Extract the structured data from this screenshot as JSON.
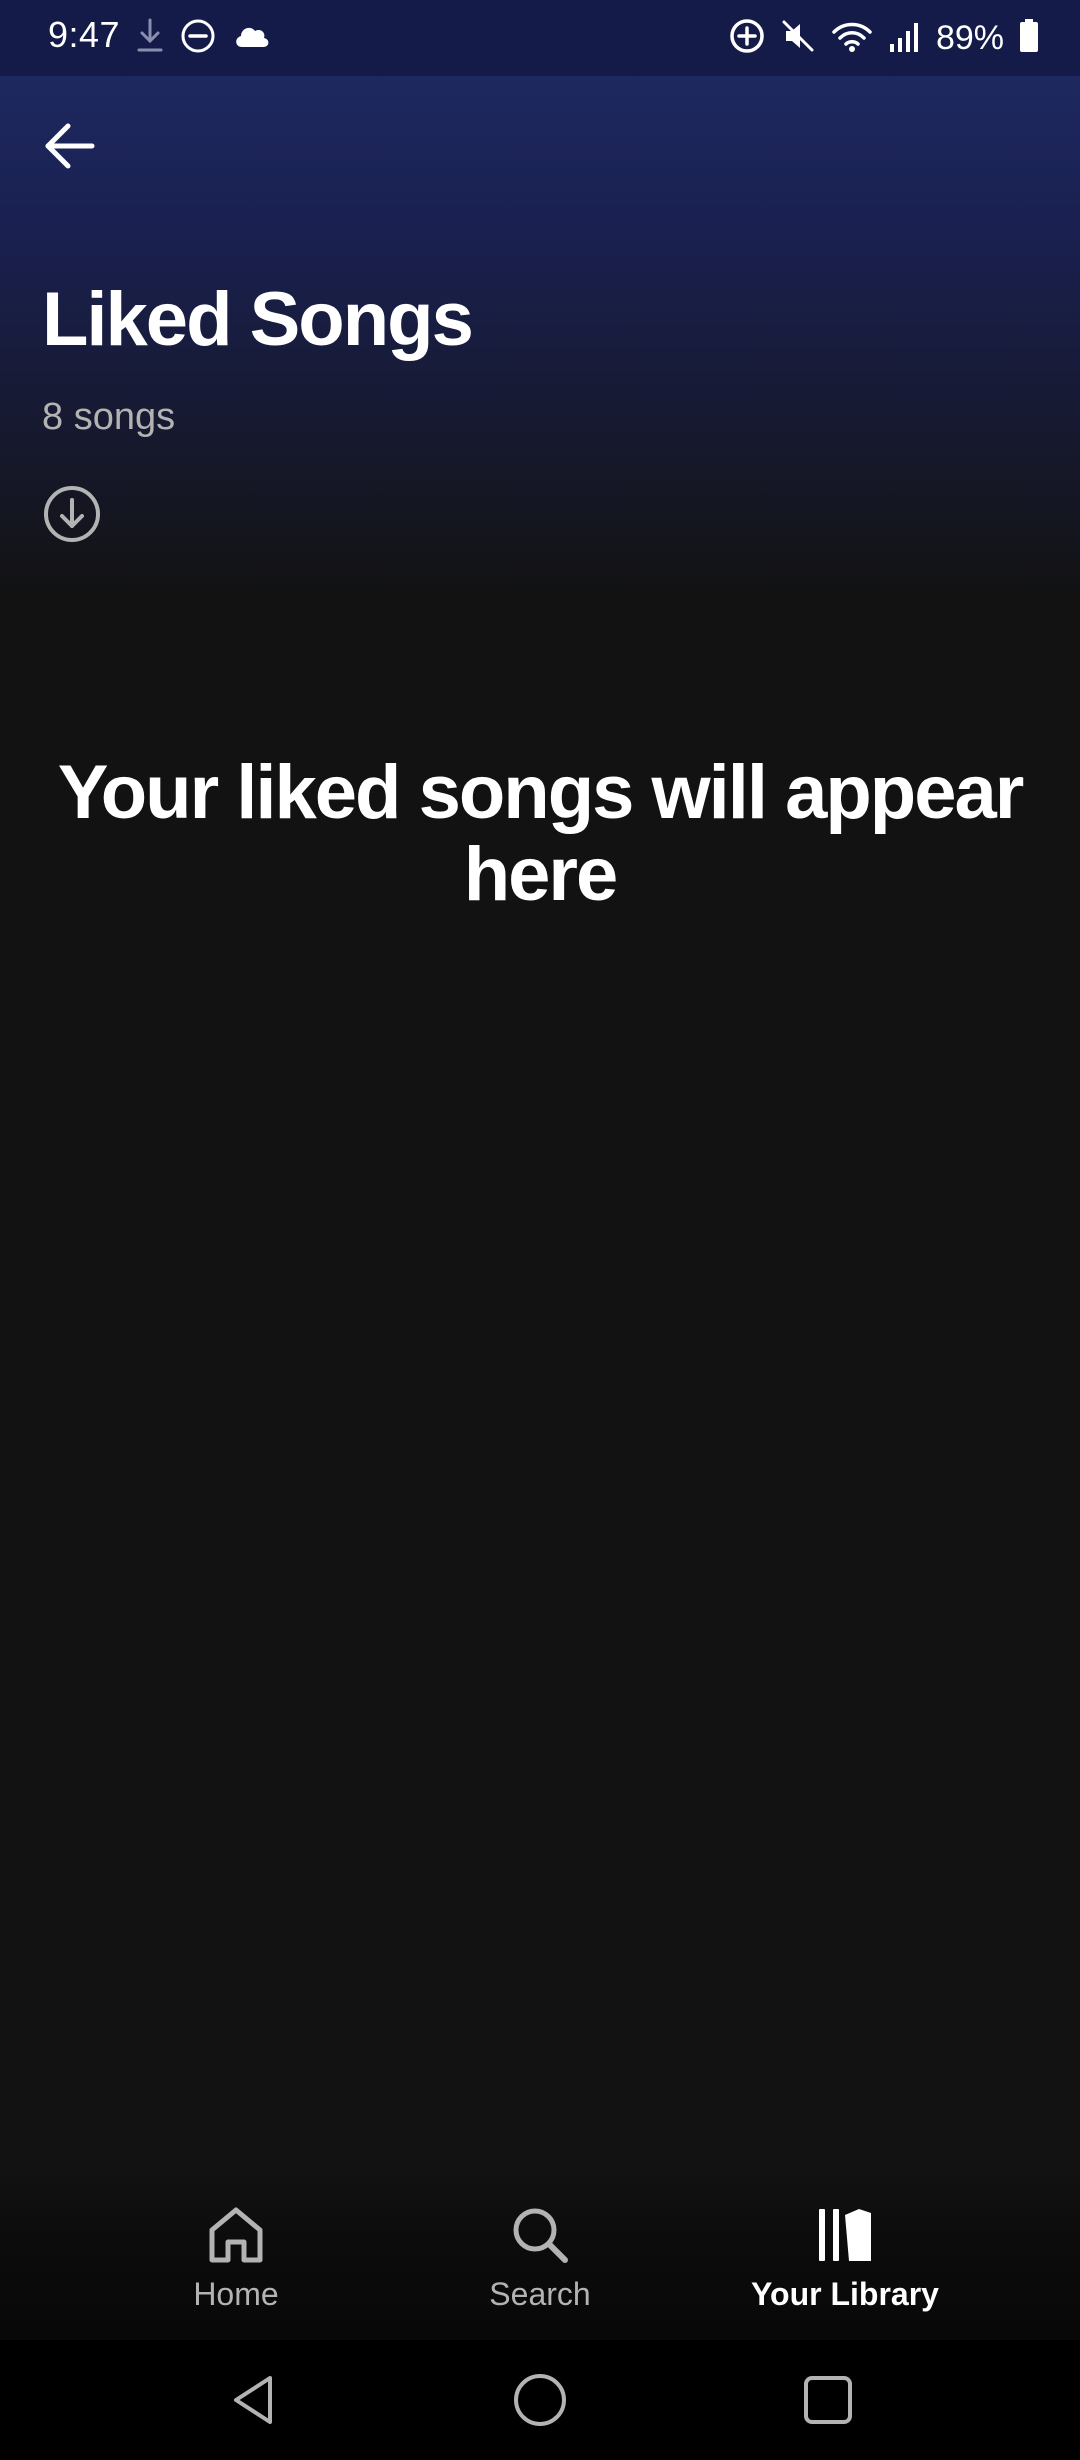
{
  "status_bar": {
    "time": "9:47",
    "battery": "89%",
    "left_icons": [
      "download-icon",
      "do-not-disturb-icon",
      "cloud-icon"
    ],
    "right_icons": [
      "data-saver-icon",
      "mute-icon",
      "wifi-icon",
      "signal-icon",
      "battery-icon"
    ]
  },
  "header": {
    "back_icon": "arrow-left-icon",
    "title": "Liked Songs",
    "song_count": "8 songs",
    "download_icon": "download-circle-icon"
  },
  "main": {
    "empty_message": "Your liked songs will appear here"
  },
  "bottom_nav": {
    "items": [
      {
        "label": "Home",
        "icon": "home-icon",
        "active": false
      },
      {
        "label": "Search",
        "icon": "search-icon",
        "active": false
      },
      {
        "label": "Your Library",
        "icon": "library-icon",
        "active": true
      }
    ]
  },
  "system_nav": {
    "buttons": [
      "back-triangle-icon",
      "home-circle-icon",
      "recents-square-icon"
    ]
  },
  "colors": {
    "background": "#121212",
    "header_gradient_top": "#1b2a6b",
    "status_bar": "#141b48",
    "text_primary": "#ffffff",
    "text_secondary": "#b3b3b3"
  }
}
